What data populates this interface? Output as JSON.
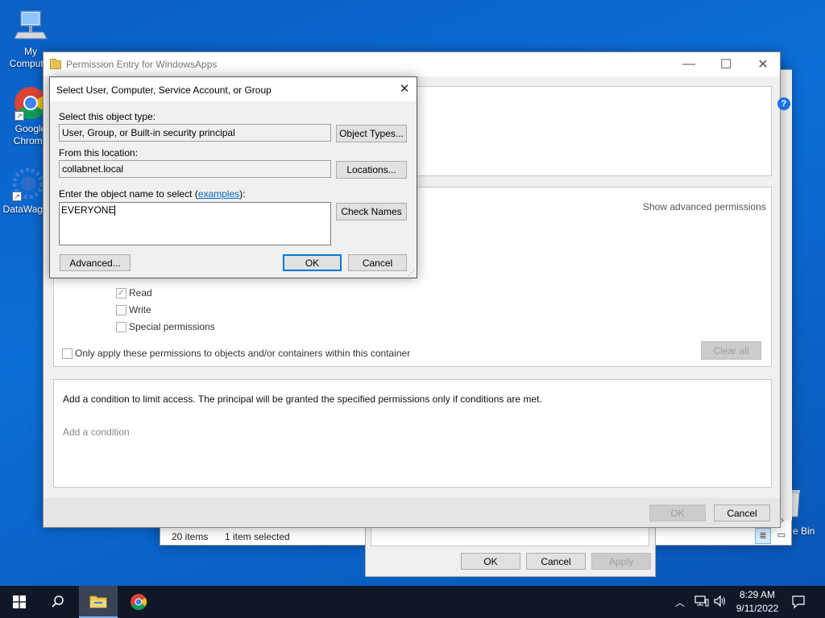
{
  "desktop": {
    "icons": [
      {
        "label": "My Computer",
        "icon": "computer-icon"
      },
      {
        "label": "Google Chrome",
        "icon": "chrome-icon"
      },
      {
        "label": "DataWagon",
        "icon": "datawagon-icon"
      },
      {
        "label": "Recycle Bin",
        "icon": "recycle-bin-icon"
      }
    ],
    "recycle_label_partial": "e Bin"
  },
  "explorer_window": {
    "status_items": "20 items",
    "status_selected": "1 item selected"
  },
  "security_dialog": {
    "ok": "OK",
    "cancel": "Cancel",
    "apply": "Apply"
  },
  "permission_entry": {
    "title": "Permission Entry for WindowsApps",
    "show_advanced": "Show advanced permissions",
    "permissions": [
      {
        "label": "Read",
        "checked": true
      },
      {
        "label": "Write",
        "checked": false
      },
      {
        "label": "Special permissions",
        "checked": false
      }
    ],
    "only_apply": "Only apply these permissions to objects and/or containers within this container",
    "clear_all": "Clear all",
    "condition_text": "Add a condition to limit access. The principal will be granted the specified permissions only if conditions are met.",
    "add_condition": "Add a condition",
    "ok": "OK",
    "cancel": "Cancel",
    "help": "?"
  },
  "select_dialog": {
    "title": "Select User, Computer, Service Account, or Group",
    "object_type_label": "Select this object type:",
    "object_type_value": "User, Group, or Built-in security principal",
    "object_types_btn": "Object Types...",
    "location_label": "From this location:",
    "location_value": "collabnet.local",
    "locations_btn": "Locations...",
    "enter_label_prefix": "Enter the object name to select (",
    "examples_link": "examples",
    "enter_label_suffix": "):",
    "object_name_value": "EVERYONE",
    "check_names_btn": "Check Names",
    "advanced_btn": "Advanced...",
    "ok_btn": "OK",
    "cancel_btn": "Cancel"
  },
  "taskbar": {
    "time": "8:29 AM",
    "date": "9/11/2022"
  }
}
